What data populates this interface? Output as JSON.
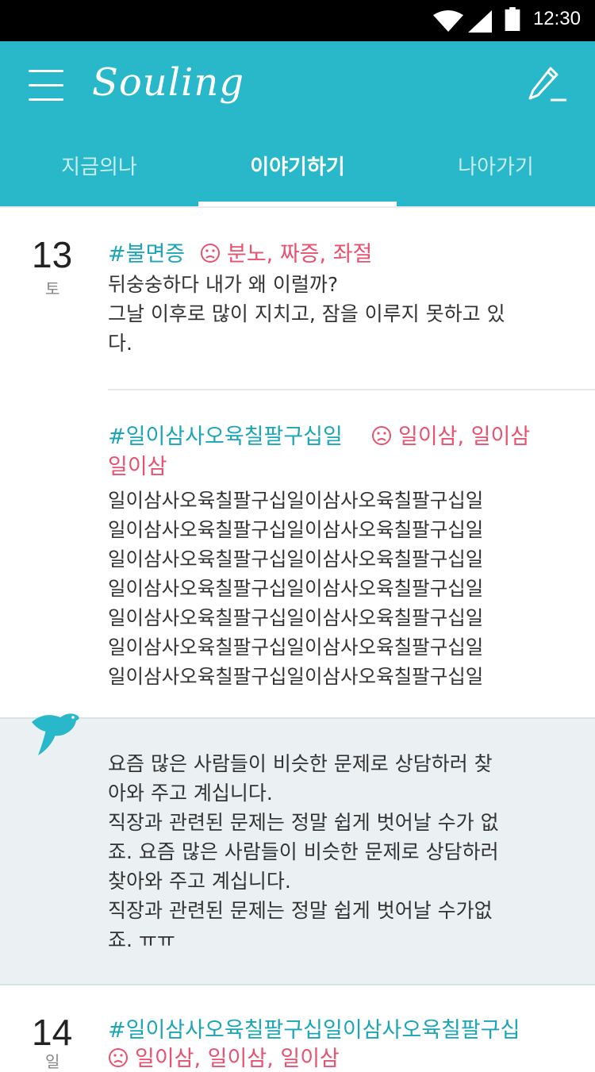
{
  "status_bar": {
    "time": "12:30"
  },
  "app": {
    "title": "Souling"
  },
  "tabs": [
    {
      "label": "지금의나"
    },
    {
      "label": "이야기하기"
    },
    {
      "label": "나아가기"
    }
  ],
  "entries": [
    {
      "date_num": "13",
      "date_day": "토",
      "items": [
        {
          "tag": "#불면증",
          "emotions": "분노, 짜증, 좌절",
          "text": "뒤숭숭하다 내가 왜 이럴까?\n그날 이후로 많이 지치고, 잠을 이루지 못하고 있\n다."
        },
        {
          "tag": "#일이삼사오육칠팔구십일",
          "emotions_line1": "일이삼, 일이삼",
          "emotions_line2": "일이삼",
          "text": "일이삼사오육칠팔구십일이삼사오육칠팔구십일\n일이삼사오육칠팔구십일이삼사오육칠팔구십일\n일이삼사오육칠팔구십일이삼사오육칠팔구십일\n일이삼사오육칠팔구십일이삼사오육칠팔구십일\n일이삼사오육칠팔구십일이삼사오육칠팔구십일\n일이삼사오육칠팔구십일이삼사오육칠팔구십일\n일이삼사오육칠팔구십일이삼사오육칠팔구십일"
        }
      ]
    },
    {
      "date_num": "14",
      "date_day": "일",
      "items": [
        {
          "tag": "#일이삼사오육칠팔구십일이삼사오육칠팔구십",
          "emotions": "일이삼, 일이삼, 일이삼"
        }
      ]
    }
  ],
  "reply": {
    "text": "요즘 많은 사람들이 비슷한 문제로 상담하러 찾\n아와 주고 계십니다.\n직장과 관련된 문제는 정말 쉽게 벗어날 수가 없\n죠. 요즘 많은 사람들이 비슷한 문제로 상담하러\n찾아와 주고 계십니다.\n직장과 관련된 문제는 정말 쉽게 벗어날 수가없\n죠. ㅠㅠ"
  },
  "colors": {
    "primary": "#28b8c9",
    "tag": "#1aa6b7",
    "emotion": "#e8516f"
  }
}
